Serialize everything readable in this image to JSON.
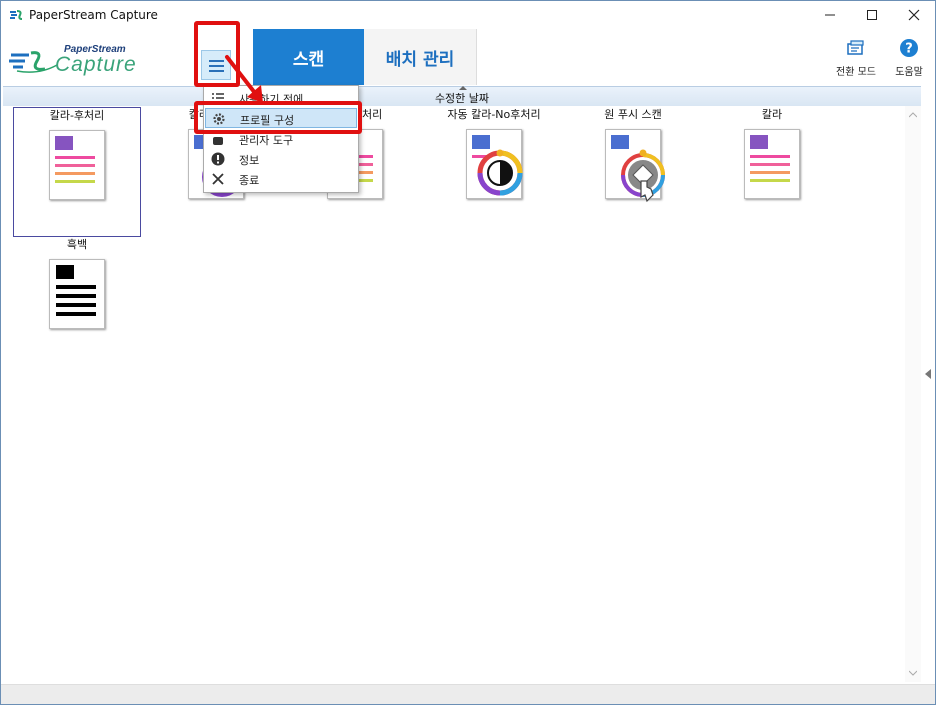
{
  "window": {
    "title": "PaperStream Capture"
  },
  "logo": {
    "brand_top": "PaperStream",
    "brand_main": "Capture"
  },
  "tabs": {
    "scan": "스캔",
    "batch": "배치 관리"
  },
  "header_buttons": {
    "switch_mode": "전환 모드",
    "help": "도움말"
  },
  "sort": {
    "label": "수정한 날짜"
  },
  "profiles": [
    {
      "label": "칼라-후처리"
    },
    {
      "label": "칼라-후처리"
    },
    {
      "label": "흑백-후처리"
    },
    {
      "label": "자동 칼라-No후처리"
    },
    {
      "label": "원 푸시 스캔"
    },
    {
      "label": "칼라"
    },
    {
      "label": "흑백"
    }
  ],
  "menu": {
    "items": [
      {
        "label": "사용하기 전에"
      },
      {
        "label": "프로필 구성"
      },
      {
        "label": "관리자 도구"
      },
      {
        "label": "정보"
      },
      {
        "label": "종료"
      }
    ]
  },
  "colors": {
    "accent": "#1d7fd1",
    "highlight_red": "#e01010"
  }
}
